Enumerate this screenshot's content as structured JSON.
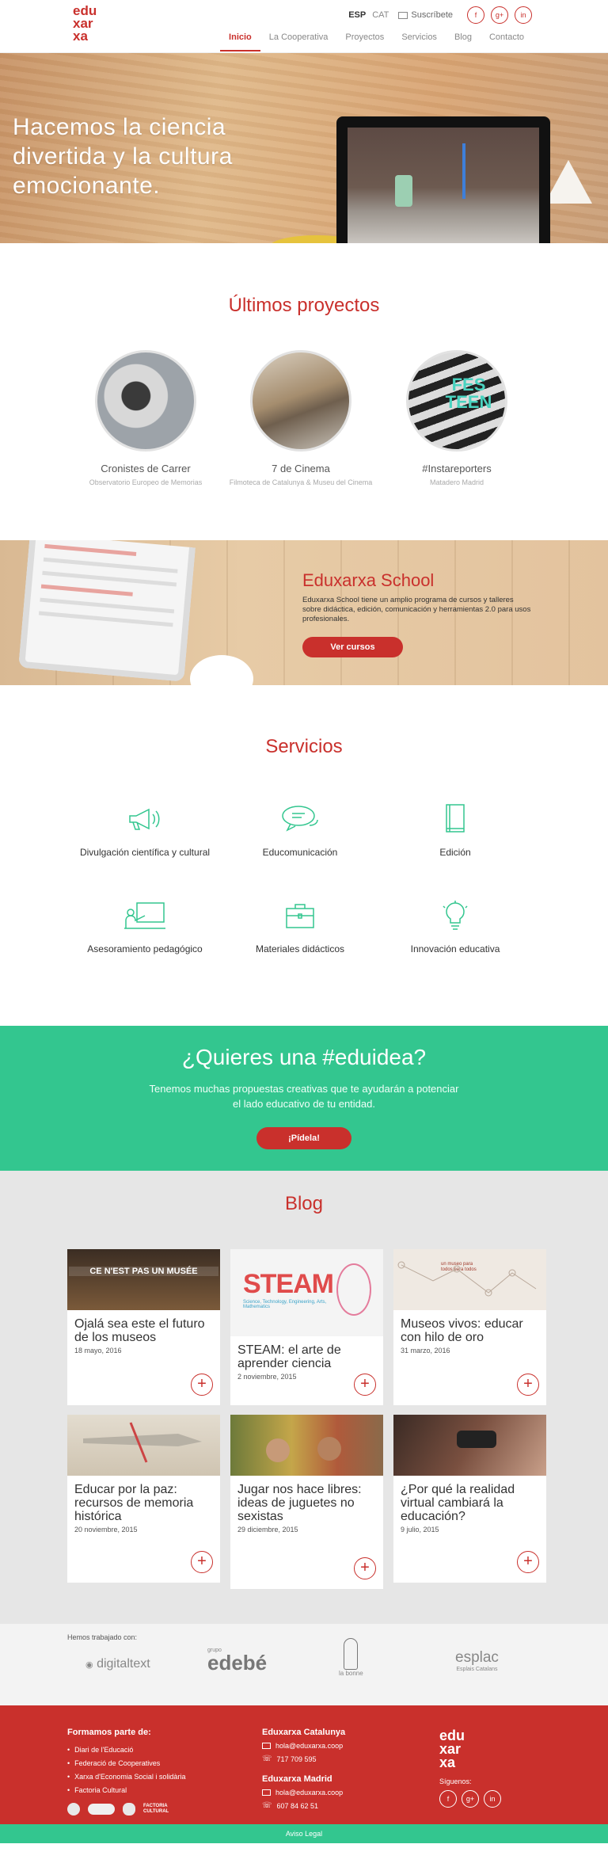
{
  "header": {
    "logo": [
      "edu",
      "xar",
      "xa"
    ],
    "languages": [
      {
        "label": "ESP",
        "active": true
      },
      {
        "label": "CAT",
        "active": false
      }
    ],
    "subscribe": "Suscríbete",
    "social": [
      "f",
      "g+",
      "in"
    ],
    "nav": [
      {
        "label": "Inicio",
        "active": true
      },
      {
        "label": "La Cooperativa",
        "active": false
      },
      {
        "label": "Proyectos",
        "active": false
      },
      {
        "label": "Servicios",
        "active": false
      },
      {
        "label": "Blog",
        "active": false
      },
      {
        "label": "Contacto",
        "active": false
      }
    ]
  },
  "hero": {
    "line1": "Hacemos la ciencia",
    "line2": "divertida y la cultura",
    "line3": "emocionante.",
    "slides": 3,
    "active_slide": 2
  },
  "projects": {
    "title": "Últimos proyectos",
    "items": [
      {
        "title": "Cronistes de Carrer",
        "subtitle": "Observatorio Europeo de Memorias"
      },
      {
        "title": "7 de Cinema",
        "subtitle": "Filmoteca de Catalunya & Museu del Cinema"
      },
      {
        "title": "#Instareporters",
        "subtitle": "Matadero Madrid"
      }
    ],
    "instareporters_art": "FES TEEN"
  },
  "school": {
    "title": "Eduxarxa School",
    "text": "Eduxarxa School tiene un amplio programa de cursos y talleres sobre didáctica, edición, comunicación y herramientas 2.0 para usos profesionales.",
    "button": "Ver cursos"
  },
  "services": {
    "title": "Servicios",
    "items": [
      {
        "label": "Divulgación científica y cultural",
        "icon": "megaphone-icon"
      },
      {
        "label": "Educomunicación",
        "icon": "speech-bubbles-icon"
      },
      {
        "label": "Edición",
        "icon": "book-icon"
      },
      {
        "label": "Asesoramiento pedagógico",
        "icon": "teacher-board-icon"
      },
      {
        "label": "Materiales didácticos",
        "icon": "toolbox-icon"
      },
      {
        "label": "Innovación educativa",
        "icon": "lightbulb-icon"
      }
    ],
    "accent": "#33c68f"
  },
  "cta": {
    "title": "¿Quieres una #eduidea?",
    "line1": "Tenemos muchas propuestas creativas que te ayudarán a potenciar",
    "line2": "el lado educativo de tu entidad.",
    "button": "¡Pídela!"
  },
  "blog": {
    "title": "Blog",
    "posts": [
      {
        "title": "Ojalá sea este el futuro de los museos",
        "date": "18 mayo, 2016",
        "thumb_text": "CE N'EST PAS UN MUSÉE"
      },
      {
        "title": "STEAM: el arte de aprender ciencia",
        "date": "2 noviembre, 2015",
        "thumb_text": "STEAM",
        "thumb_sub": "Science, Technology, Engineering, Arts, Mathematics"
      },
      {
        "title": "Museos vivos: educar con hilo de oro",
        "date": "31 marzo, 2016",
        "thumb_text": "un museo para todos para todos"
      },
      {
        "title": "Educar por la paz: recursos de memoria histórica",
        "date": "20 noviembre, 2015"
      },
      {
        "title": "Jugar nos hace libres: ideas de juguetes no sexistas",
        "date": "29 diciembre, 2015"
      },
      {
        "title": "¿Por qué la realidad virtual cambiará la educación?",
        "date": "9 julio, 2015"
      }
    ]
  },
  "clients": {
    "label": "Hemos trabajado con:",
    "logos": [
      "digitaltext",
      "grupo",
      "edebé",
      "la bonne",
      "esplac",
      "Esplais Catalans"
    ]
  },
  "footer": {
    "col1_title": "Formamos parte de:",
    "col1_items": [
      "Diari de l'Educació",
      "Federació de Cooperatives",
      "Xarxa d'Economia Social i solidària",
      "Factoria Cultural"
    ],
    "factoria_badge": "FACTORIA CULTURAL",
    "cat_title": "Eduxarxa Catalunya",
    "cat_email": "hola@eduxarxa.coop",
    "cat_phone": "717 709 595",
    "mad_title": "Eduxarxa Madrid",
    "mad_email": "hola@eduxarxa.coop",
    "mad_phone": "607 84 62 51",
    "follow": "Síguenos:",
    "social": [
      "f",
      "g+",
      "in"
    ],
    "legal": "Aviso Legal"
  }
}
